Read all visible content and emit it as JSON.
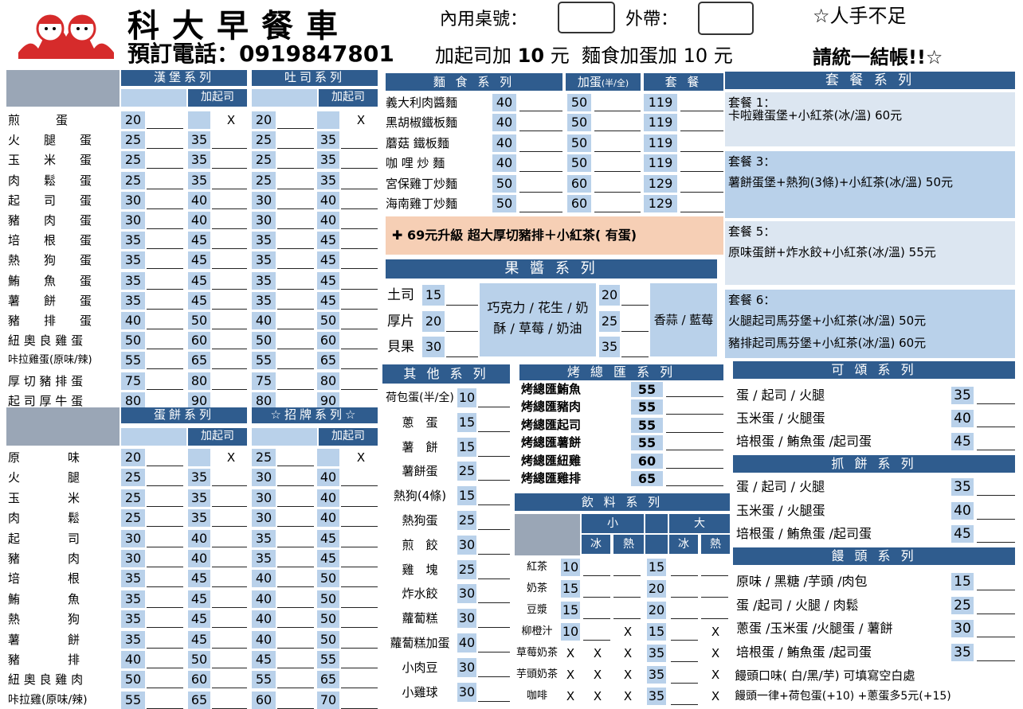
{
  "header": {
    "shop_name": "科大早餐車",
    "phone_label": "預訂電話：",
    "phone": "0919847801",
    "dine_in_label": "內用桌號：",
    "takeout_label": "外帶：",
    "notice1": "☆人手不足",
    "notice2": "請統一結帳!!☆",
    "cheese_note": "加起司加",
    "cheese_price": "10",
    "yuan1": "元",
    "noodle_note": "麵食加蛋加",
    "noodle_price": "10",
    "yuan2": "元"
  },
  "burger_toast": {
    "title_burger": "漢堡系列",
    "title_toast": "吐司系列",
    "add_cheese": "加起司",
    "x": "X",
    "items": [
      [
        "煎　　　蛋",
        "20",
        "X",
        "20",
        "X"
      ],
      [
        "火　　腿　　蛋",
        "25",
        "35",
        "25",
        "35"
      ],
      [
        "玉　　米　　蛋",
        "25",
        "35",
        "25",
        "35"
      ],
      [
        "肉　　鬆　　蛋",
        "25",
        "35",
        "25",
        "35"
      ],
      [
        "起　　司　　蛋",
        "30",
        "40",
        "30",
        "40"
      ],
      [
        "豬　　肉　　蛋",
        "30",
        "40",
        "30",
        "40"
      ],
      [
        "培　　根　　蛋",
        "35",
        "45",
        "35",
        "45"
      ],
      [
        "熱　　狗　　蛋",
        "35",
        "45",
        "35",
        "45"
      ],
      [
        "鮪　　魚　　蛋",
        "35",
        "45",
        "35",
        "45"
      ],
      [
        "薯　　餅　　蛋",
        "35",
        "45",
        "35",
        "45"
      ],
      [
        "豬　　排　　蛋",
        "40",
        "50",
        "40",
        "50"
      ],
      [
        "紐 奧 良 雞 蛋",
        "50",
        "60",
        "50",
        "60"
      ],
      [
        "咔拉雞蛋(原味/辣)",
        "55",
        "65",
        "55",
        "65"
      ],
      [
        "厚 切 豬 排 蛋",
        "75",
        "80",
        "75",
        "80"
      ],
      [
        "起 司 厚 牛 蛋",
        "80",
        "90",
        "80",
        "90"
      ]
    ]
  },
  "eggpancake": {
    "title_pancake": "蛋餅系列",
    "title_sign": "☆招牌系列☆",
    "add_cheese": "加起司",
    "items": [
      [
        "原　　　　味",
        "20",
        "X",
        "25",
        "X"
      ],
      [
        "火　　　　腿",
        "25",
        "35",
        "30",
        "40"
      ],
      [
        "玉　　　　米",
        "25",
        "35",
        "30",
        "40"
      ],
      [
        "肉　　　　鬆",
        "25",
        "35",
        "30",
        "40"
      ],
      [
        "起　　　　司",
        "30",
        "40",
        "35",
        "45"
      ],
      [
        "豬　　　　肉",
        "30",
        "40",
        "35",
        "45"
      ],
      [
        "培　　　　根",
        "35",
        "45",
        "40",
        "50"
      ],
      [
        "鮪　　　　魚",
        "35",
        "45",
        "40",
        "50"
      ],
      [
        "熱　　　　狗",
        "35",
        "45",
        "40",
        "50"
      ],
      [
        "薯　　　　餅",
        "35",
        "45",
        "40",
        "50"
      ],
      [
        "豬　　　　排",
        "40",
        "50",
        "45",
        "55"
      ],
      [
        "紐 奧 良 雞 肉",
        "50",
        "60",
        "55",
        "65"
      ],
      [
        "咔拉雞(原味/辣)",
        "55",
        "65",
        "60",
        "70"
      ]
    ]
  },
  "noodles": {
    "title": "麵 食 系 列",
    "egg_title": "加蛋",
    "egg_sub": "(半/全)",
    "set_title": "套 餐",
    "items": [
      [
        "義大利肉醬麵",
        "40",
        "50",
        "119"
      ],
      [
        "黑胡椒鐵板麵",
        "40",
        "50",
        "119"
      ],
      [
        "蘑菇 鐵板麵",
        "40",
        "50",
        "119"
      ],
      [
        "咖 哩 炒 麵",
        "40",
        "50",
        "119"
      ],
      [
        "宮保雞丁炒麵",
        "50",
        "60",
        "129"
      ],
      [
        "海南雞丁炒麵",
        "50",
        "60",
        "129"
      ]
    ],
    "upgrade": "✚ 69元升級 超大厚切豬排＋小紅茶( 有蛋)"
  },
  "jam": {
    "title": "果 醬 系 列",
    "items": [
      [
        "土司",
        "15",
        "20"
      ],
      [
        "厚片",
        "20",
        "25"
      ],
      [
        "貝果",
        "30",
        "35"
      ]
    ],
    "flavors": "巧克力 / 花生 / 奶酥 / 草莓 / 奶油",
    "flavors2": "香蒜 / 藍莓"
  },
  "combos": {
    "title": "套 餐 系 列",
    "items": [
      {
        "name": "套餐 1：",
        "desc": "卡啦雞蛋堡+小紅茶(冰/溫) 60元"
      },
      {
        "name": "套餐 3：",
        "desc": "薯餅蛋堡+熱狗(3條)+小紅茶(冰/溫)  50元"
      },
      {
        "name": "套餐 5：",
        "desc": "原味蛋餅+炸水餃+小紅茶(冰/溫)  55元"
      },
      {
        "name": "套餐 6：",
        "desc": "火腿起司馬芬堡+小紅茶(冰/溫)  50元",
        "desc2": "豬排起司馬芬堡+小紅茶(冰/溫)  60元"
      }
    ]
  },
  "others": {
    "title": "其 他 系 列",
    "items": [
      [
        "荷包蛋(半/全)",
        "10"
      ],
      [
        "蔥　蛋",
        "15"
      ],
      [
        "薯　餅",
        "15"
      ],
      [
        "薯餅蛋",
        "25"
      ],
      [
        "熱狗(4條)",
        "15"
      ],
      [
        "熱狗蛋",
        "25"
      ],
      [
        "煎　餃",
        "30"
      ],
      [
        "雞　塊",
        "25"
      ],
      [
        "炸水餃",
        "30"
      ],
      [
        "蘿蔔糕",
        "30"
      ],
      [
        "蘿蔔糕加蛋",
        "40"
      ],
      [
        "小肉豆",
        "30"
      ],
      [
        "小雞球",
        "30"
      ]
    ]
  },
  "roast": {
    "title": "烤 總 匯 系 列",
    "items": [
      [
        "烤總匯鮪魚",
        "55"
      ],
      [
        "烤總匯豬肉",
        "55"
      ],
      [
        "烤總匯起司",
        "55"
      ],
      [
        "烤總匯薯餅",
        "55"
      ],
      [
        "烤總匯紐雞",
        "60"
      ],
      [
        "烤總匯雞排",
        "65"
      ]
    ]
  },
  "drinks": {
    "title": "飲 料 系 列",
    "small": "小",
    "large": "大",
    "ice": "冰",
    "hot": "熱",
    "items": [
      [
        "紅茶",
        "10",
        "",
        "",
        "15",
        "",
        ""
      ],
      [
        "奶茶",
        "15",
        "",
        "",
        "20",
        "",
        ""
      ],
      [
        "豆漿",
        "15",
        "",
        "",
        "20",
        "",
        ""
      ],
      [
        "柳橙汁",
        "10",
        "",
        "X",
        "15",
        "",
        "X"
      ],
      [
        "草莓奶茶",
        "X",
        "X",
        "X",
        "35",
        "",
        "X"
      ],
      [
        "芋頭奶茶",
        "X",
        "X",
        "X",
        "35",
        "",
        "X"
      ],
      [
        "咖啡",
        "X",
        "X",
        "X",
        "35",
        "",
        "X"
      ]
    ]
  },
  "kesong": {
    "title": "可 頌 系 列",
    "items": [
      [
        "蛋 / 起司 / 火腿",
        "35"
      ],
      [
        "玉米蛋 / 火腿蛋",
        "40"
      ],
      [
        "培根蛋 / 鮪魚蛋 /起司蛋",
        "45"
      ]
    ]
  },
  "zhuabing": {
    "title": "抓 餅 系 列",
    "items": [
      [
        "蛋 / 起司 / 火腿",
        "35"
      ],
      [
        "玉米蛋 / 火腿蛋",
        "40"
      ],
      [
        "培根蛋 / 鮪魚蛋 /起司蛋",
        "45"
      ]
    ]
  },
  "mantou": {
    "title": "饅 頭 系 列",
    "items": [
      [
        "原味 / 黑糖 /芋頭 /肉包",
        "15"
      ],
      [
        "蛋 /起司 / 火腿 / 肉鬆",
        "25"
      ],
      [
        "蔥蛋 /玉米蛋 /火腿蛋 / 薯餅",
        "30"
      ],
      [
        "培根蛋 / 鮪魚蛋 /起司蛋",
        "35"
      ]
    ],
    "note1": "饅頭口味( 白/黑/芋) 可填寫空白處",
    "note2": "饅頭一律+荷包蛋(+10)  +蔥蛋多5元(+15)"
  }
}
